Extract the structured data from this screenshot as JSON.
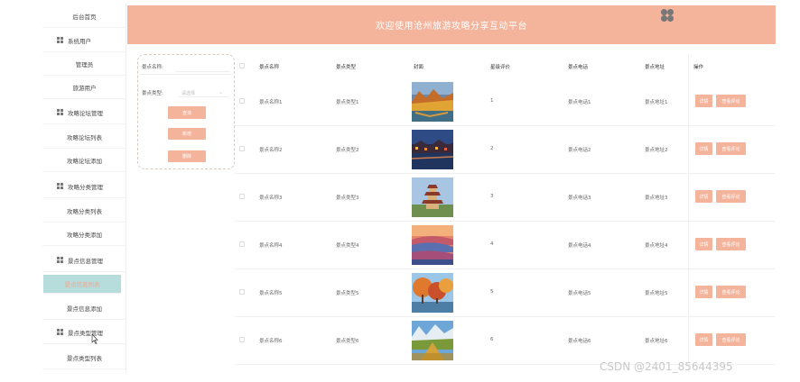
{
  "header": {
    "title": "欢迎使用沧州旅游攻略分享互动平台"
  },
  "sidebar": {
    "items": [
      {
        "label": "后台首页",
        "group": false,
        "active": false
      },
      {
        "label": "系统用户",
        "group": true,
        "active": false
      },
      {
        "label": "管理员",
        "group": false,
        "active": false
      },
      {
        "label": "旅游用户",
        "group": false,
        "active": false
      },
      {
        "label": "攻略论坛管理",
        "group": true,
        "active": false
      },
      {
        "label": "攻略论坛列表",
        "group": false,
        "active": false
      },
      {
        "label": "攻略论坛添加",
        "group": false,
        "active": false
      },
      {
        "label": "攻略分类管理",
        "group": true,
        "active": false
      },
      {
        "label": "攻略分类列表",
        "group": false,
        "active": false
      },
      {
        "label": "攻略分类添加",
        "group": false,
        "active": false
      },
      {
        "label": "景点信息管理",
        "group": true,
        "active": false
      },
      {
        "label": "景点信息列表",
        "group": false,
        "active": true
      },
      {
        "label": "景点信息添加",
        "group": false,
        "active": false
      },
      {
        "label": "景点类型管理",
        "group": true,
        "active": false
      },
      {
        "label": "景点类型列表",
        "group": false,
        "active": false
      }
    ]
  },
  "search": {
    "name_label": "景点名称:",
    "type_label": "景点类型:",
    "type_placeholder": "请选择",
    "query_button": "查询",
    "add_button": "新增",
    "delete_button": "删除"
  },
  "table": {
    "headers": [
      "景点名称",
      "景点类型",
      "封面",
      "星级评价",
      "景点电话",
      "景点地址",
      "操作"
    ],
    "rows": [
      {
        "name": "景点名称1",
        "type": "景点类型1",
        "rating": "1",
        "phone": "景点电话1",
        "address": "景点地址1",
        "cover": "autumn-lake"
      },
      {
        "name": "景点名称2",
        "type": "景点类型2",
        "rating": "2",
        "phone": "景点电话2",
        "address": "景点地址2",
        "cover": "night-town"
      },
      {
        "name": "景点名称3",
        "type": "景点类型3",
        "rating": "3",
        "phone": "景点电话3",
        "address": "景点地址3",
        "cover": "pagoda"
      },
      {
        "name": "景点名称4",
        "type": "景点类型4",
        "rating": "4",
        "phone": "景点电话4",
        "address": "景点地址4",
        "cover": "sunset-terraces"
      },
      {
        "name": "景点名称5",
        "type": "景点类型5",
        "rating": "5",
        "phone": "景点电话5",
        "address": "景点地址5",
        "cover": "autumn-trees"
      },
      {
        "name": "景点名称6",
        "type": "景点类型6",
        "rating": "6",
        "phone": "景点电话6",
        "address": "景点地址6",
        "cover": "mountain-valley"
      }
    ],
    "detail_button": "详情",
    "review_button": "查看评论"
  },
  "watermark": "CSDN @2401_85644395",
  "colors": {
    "accent": "#f4b49c",
    "active_bg": "#b6dcdc"
  }
}
